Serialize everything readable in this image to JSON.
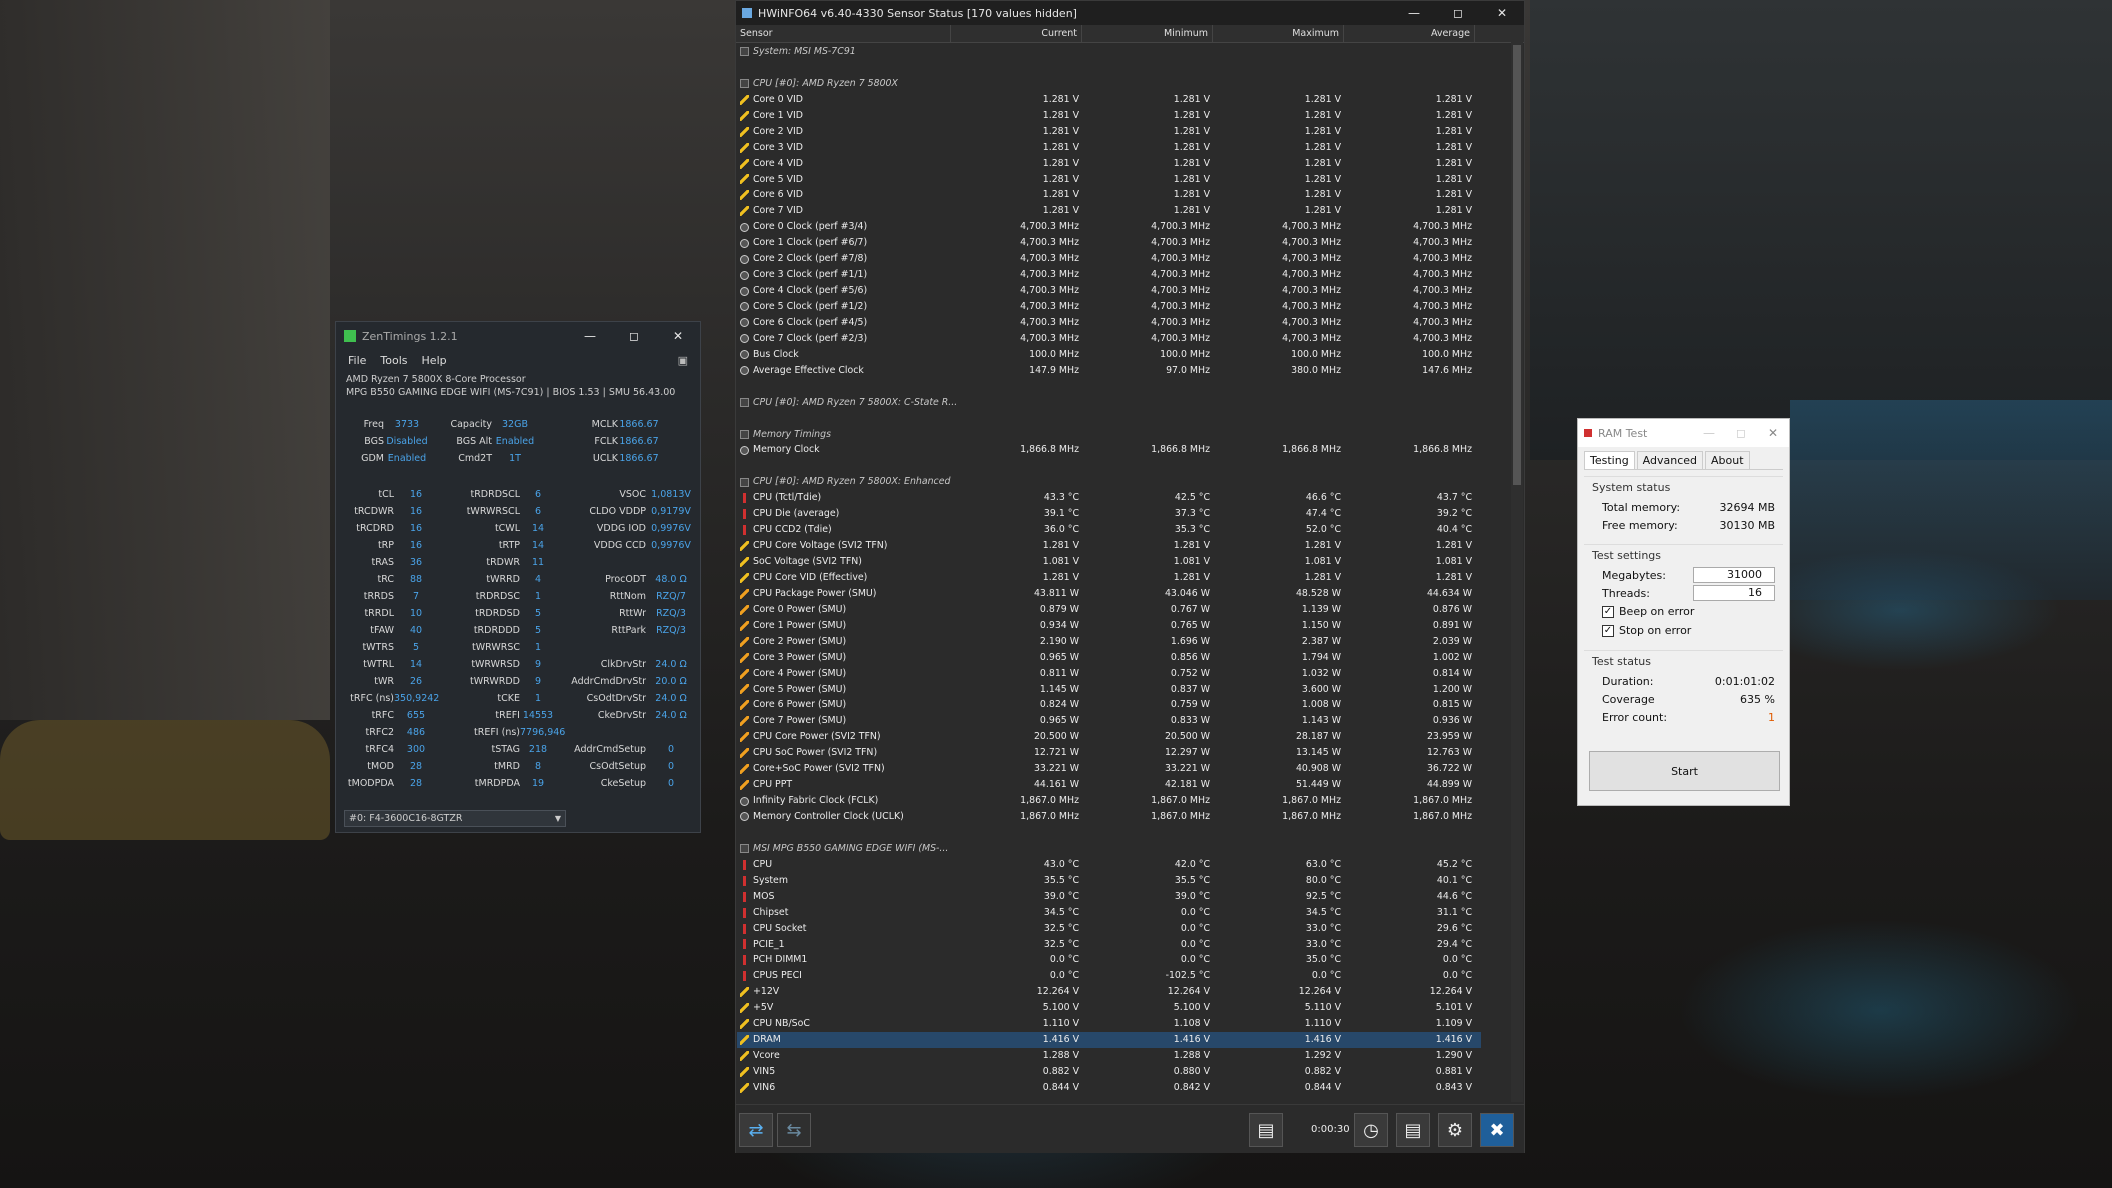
{
  "hwinfo": {
    "title": "HWiNFO64 v6.40-4330 Sensor Status [170 values hidden]",
    "columns": [
      "Sensor",
      "Current",
      "Minimum",
      "Maximum",
      "Average"
    ],
    "rows": [
      {
        "t": "grp",
        "n": "System: MSI MS-7C91"
      },
      {
        "t": "gap"
      },
      {
        "t": "grp",
        "n": "CPU [#0]: AMD Ryzen 7 5800X"
      },
      {
        "t": "volt",
        "n": "Core 0 VID",
        "v": [
          "1.281 V",
          "1.281 V",
          "1.281 V",
          "1.281 V"
        ]
      },
      {
        "t": "volt",
        "n": "Core 1 VID",
        "v": [
          "1.281 V",
          "1.281 V",
          "1.281 V",
          "1.281 V"
        ]
      },
      {
        "t": "volt",
        "n": "Core 2 VID",
        "v": [
          "1.281 V",
          "1.281 V",
          "1.281 V",
          "1.281 V"
        ]
      },
      {
        "t": "volt",
        "n": "Core 3 VID",
        "v": [
          "1.281 V",
          "1.281 V",
          "1.281 V",
          "1.281 V"
        ]
      },
      {
        "t": "volt",
        "n": "Core 4 VID",
        "v": [
          "1.281 V",
          "1.281 V",
          "1.281 V",
          "1.281 V"
        ]
      },
      {
        "t": "volt",
        "n": "Core 5 VID",
        "v": [
          "1.281 V",
          "1.281 V",
          "1.281 V",
          "1.281 V"
        ]
      },
      {
        "t": "volt",
        "n": "Core 6 VID",
        "v": [
          "1.281 V",
          "1.281 V",
          "1.281 V",
          "1.281 V"
        ]
      },
      {
        "t": "volt",
        "n": "Core 7 VID",
        "v": [
          "1.281 V",
          "1.281 V",
          "1.281 V",
          "1.281 V"
        ]
      },
      {
        "t": "clk",
        "n": "Core 0 Clock (perf #3/4)",
        "v": [
          "4,700.3 MHz",
          "4,700.3 MHz",
          "4,700.3 MHz",
          "4,700.3 MHz"
        ]
      },
      {
        "t": "clk",
        "n": "Core 1 Clock (perf #6/7)",
        "v": [
          "4,700.3 MHz",
          "4,700.3 MHz",
          "4,700.3 MHz",
          "4,700.3 MHz"
        ]
      },
      {
        "t": "clk",
        "n": "Core 2 Clock (perf #7/8)",
        "v": [
          "4,700.3 MHz",
          "4,700.3 MHz",
          "4,700.3 MHz",
          "4,700.3 MHz"
        ]
      },
      {
        "t": "clk",
        "n": "Core 3 Clock (perf #1/1)",
        "v": [
          "4,700.3 MHz",
          "4,700.3 MHz",
          "4,700.3 MHz",
          "4,700.3 MHz"
        ]
      },
      {
        "t": "clk",
        "n": "Core 4 Clock (perf #5/6)",
        "v": [
          "4,700.3 MHz",
          "4,700.3 MHz",
          "4,700.3 MHz",
          "4,700.3 MHz"
        ]
      },
      {
        "t": "clk",
        "n": "Core 5 Clock (perf #1/2)",
        "v": [
          "4,700.3 MHz",
          "4,700.3 MHz",
          "4,700.3 MHz",
          "4,700.3 MHz"
        ]
      },
      {
        "t": "clk",
        "n": "Core 6 Clock (perf #4/5)",
        "v": [
          "4,700.3 MHz",
          "4,700.3 MHz",
          "4,700.3 MHz",
          "4,700.3 MHz"
        ]
      },
      {
        "t": "clk",
        "n": "Core 7 Clock (perf #2/3)",
        "v": [
          "4,700.3 MHz",
          "4,700.3 MHz",
          "4,700.3 MHz",
          "4,700.3 MHz"
        ]
      },
      {
        "t": "clk",
        "n": "Bus Clock",
        "v": [
          "100.0 MHz",
          "100.0 MHz",
          "100.0 MHz",
          "100.0 MHz"
        ]
      },
      {
        "t": "clk",
        "n": "Average Effective Clock",
        "v": [
          "147.9 MHz",
          "97.0 MHz",
          "380.0 MHz",
          "147.6 MHz"
        ]
      },
      {
        "t": "gap"
      },
      {
        "t": "grp",
        "n": "CPU [#0]: AMD Ryzen 7 5800X: C-State R..."
      },
      {
        "t": "gap"
      },
      {
        "t": "grp",
        "n": "Memory Timings"
      },
      {
        "t": "clk",
        "n": "Memory Clock",
        "v": [
          "1,866.8 MHz",
          "1,866.8 MHz",
          "1,866.8 MHz",
          "1,866.8 MHz"
        ]
      },
      {
        "t": "gap"
      },
      {
        "t": "grp",
        "n": "CPU [#0]: AMD Ryzen 7 5800X: Enhanced"
      },
      {
        "t": "temp",
        "n": "CPU (Tctl/Tdie)",
        "v": [
          "43.3 °C",
          "42.5 °C",
          "46.6 °C",
          "43.7 °C"
        ]
      },
      {
        "t": "temp",
        "n": "CPU Die (average)",
        "v": [
          "39.1 °C",
          "37.3 °C",
          "47.4 °C",
          "39.2 °C"
        ]
      },
      {
        "t": "temp",
        "n": "CPU CCD2 (Tdie)",
        "v": [
          "36.0 °C",
          "35.3 °C",
          "52.0 °C",
          "40.4 °C"
        ]
      },
      {
        "t": "volt",
        "n": "CPU Core Voltage (SVI2 TFN)",
        "v": [
          "1.281 V",
          "1.281 V",
          "1.281 V",
          "1.281 V"
        ]
      },
      {
        "t": "volt",
        "n": "SoC Voltage (SVI2 TFN)",
        "v": [
          "1.081 V",
          "1.081 V",
          "1.081 V",
          "1.081 V"
        ]
      },
      {
        "t": "volt",
        "n": "CPU Core VID (Effective)",
        "v": [
          "1.281 V",
          "1.281 V",
          "1.281 V",
          "1.281 V"
        ]
      },
      {
        "t": "pwr",
        "n": "CPU Package Power (SMU)",
        "v": [
          "43.811 W",
          "43.046 W",
          "48.528 W",
          "44.634 W"
        ]
      },
      {
        "t": "pwr",
        "n": "Core 0 Power (SMU)",
        "v": [
          "0.879 W",
          "0.767 W",
          "1.139 W",
          "0.876 W"
        ]
      },
      {
        "t": "pwr",
        "n": "Core 1 Power (SMU)",
        "v": [
          "0.934 W",
          "0.765 W",
          "1.150 W",
          "0.891 W"
        ]
      },
      {
        "t": "pwr",
        "n": "Core 2 Power (SMU)",
        "v": [
          "2.190 W",
          "1.696 W",
          "2.387 W",
          "2.039 W"
        ]
      },
      {
        "t": "pwr",
        "n": "Core 3 Power (SMU)",
        "v": [
          "0.965 W",
          "0.856 W",
          "1.794 W",
          "1.002 W"
        ]
      },
      {
        "t": "pwr",
        "n": "Core 4 Power (SMU)",
        "v": [
          "0.811 W",
          "0.752 W",
          "1.032 W",
          "0.814 W"
        ]
      },
      {
        "t": "pwr",
        "n": "Core 5 Power (SMU)",
        "v": [
          "1.145 W",
          "0.837 W",
          "3.600 W",
          "1.200 W"
        ]
      },
      {
        "t": "pwr",
        "n": "Core 6 Power (SMU)",
        "v": [
          "0.824 W",
          "0.759 W",
          "1.008 W",
          "0.815 W"
        ]
      },
      {
        "t": "pwr",
        "n": "Core 7 Power (SMU)",
        "v": [
          "0.965 W",
          "0.833 W",
          "1.143 W",
          "0.936 W"
        ]
      },
      {
        "t": "pwr",
        "n": "CPU Core Power (SVI2 TFN)",
        "v": [
          "20.500 W",
          "20.500 W",
          "28.187 W",
          "23.959 W"
        ]
      },
      {
        "t": "pwr",
        "n": "CPU SoC Power (SVI2 TFN)",
        "v": [
          "12.721 W",
          "12.297 W",
          "13.145 W",
          "12.763 W"
        ]
      },
      {
        "t": "pwr",
        "n": "Core+SoC Power (SVI2 TFN)",
        "v": [
          "33.221 W",
          "33.221 W",
          "40.908 W",
          "36.722 W"
        ]
      },
      {
        "t": "pwr",
        "n": "CPU PPT",
        "v": [
          "44.161 W",
          "42.181 W",
          "51.449 W",
          "44.899 W"
        ]
      },
      {
        "t": "clk",
        "n": "Infinity Fabric Clock (FCLK)",
        "v": [
          "1,867.0 MHz",
          "1,867.0 MHz",
          "1,867.0 MHz",
          "1,867.0 MHz"
        ]
      },
      {
        "t": "clk",
        "n": "Memory Controller Clock (UCLK)",
        "v": [
          "1,867.0 MHz",
          "1,867.0 MHz",
          "1,867.0 MHz",
          "1,867.0 MHz"
        ]
      },
      {
        "t": "gap"
      },
      {
        "t": "grp",
        "n": "MSI MPG B550 GAMING EDGE WIFI (MS-..."
      },
      {
        "t": "temp",
        "n": "CPU",
        "v": [
          "43.0 °C",
          "42.0 °C",
          "63.0 °C",
          "45.2 °C"
        ]
      },
      {
        "t": "temp",
        "n": "System",
        "v": [
          "35.5 °C",
          "35.5 °C",
          "80.0 °C",
          "40.1 °C"
        ]
      },
      {
        "t": "temp",
        "n": "MOS",
        "v": [
          "39.0 °C",
          "39.0 °C",
          "92.5 °C",
          "44.6 °C"
        ]
      },
      {
        "t": "temp",
        "n": "Chipset",
        "v": [
          "34.5 °C",
          "0.0 °C",
          "34.5 °C",
          "31.1 °C"
        ]
      },
      {
        "t": "temp",
        "n": "CPU Socket",
        "v": [
          "32.5 °C",
          "0.0 °C",
          "33.0 °C",
          "29.6 °C"
        ]
      },
      {
        "t": "temp",
        "n": "PCIE_1",
        "v": [
          "32.5 °C",
          "0.0 °C",
          "33.0 °C",
          "29.4 °C"
        ]
      },
      {
        "t": "temp",
        "n": "PCH DIMM1",
        "v": [
          "0.0 °C",
          "0.0 °C",
          "35.0 °C",
          "0.0 °C"
        ]
      },
      {
        "t": "temp",
        "n": "CPUS PECI",
        "v": [
          "0.0 °C",
          "-102.5 °C",
          "0.0 °C",
          "0.0 °C"
        ]
      },
      {
        "t": "volt",
        "n": "+12V",
        "v": [
          "12.264 V",
          "12.264 V",
          "12.264 V",
          "12.264 V"
        ]
      },
      {
        "t": "volt",
        "n": "+5V",
        "v": [
          "5.100 V",
          "5.100 V",
          "5.110 V",
          "5.101 V"
        ]
      },
      {
        "t": "volt",
        "n": "CPU NB/SoC",
        "v": [
          "1.110 V",
          "1.108 V",
          "1.110 V",
          "1.109 V"
        ]
      },
      {
        "t": "volt",
        "n": "DRAM",
        "v": [
          "1.416 V",
          "1.416 V",
          "1.416 V",
          "1.416 V"
        ],
        "sel": true
      },
      {
        "t": "volt",
        "n": "Vcore",
        "v": [
          "1.288 V",
          "1.288 V",
          "1.292 V",
          "1.290 V"
        ]
      },
      {
        "t": "volt",
        "n": "VIN5",
        "v": [
          "0.882 V",
          "0.880 V",
          "0.882 V",
          "0.881 V"
        ]
      },
      {
        "t": "volt",
        "n": "VIN6",
        "v": [
          "0.844 V",
          "0.842 V",
          "0.844 V",
          "0.843 V"
        ]
      }
    ],
    "footer": {
      "elapsed": "0:00:30"
    }
  },
  "zentimings": {
    "title": "ZenTimings 1.2.1",
    "menu": [
      "File",
      "Tools",
      "Help"
    ],
    "cpu": "AMD Ryzen 7 5800X 8-Core Processor",
    "board": "MPG B550 GAMING EDGE WIFI (MS-7C91) | BIOS 1.53 | SMU 56.43.00",
    "top": [
      [
        "Freq",
        "3733",
        "Capacity",
        "32GB",
        "MCLK",
        "1866.67"
      ],
      [
        "BGS",
        "Disabled",
        "BGS Alt",
        "Enabled",
        "FCLK",
        "1866.67"
      ],
      [
        "GDM",
        "Enabled",
        "Cmd2T",
        "1T",
        "UCLK",
        "1866.67"
      ]
    ],
    "timings": [
      [
        "tCL",
        "16",
        "tRDRDSCL",
        "6"
      ],
      [
        "tRCDWR",
        "16",
        "tWRWRSCL",
        "6"
      ],
      [
        "tRCDRD",
        "16",
        "tCWL",
        "14"
      ],
      [
        "tRP",
        "16",
        "tRTP",
        "14"
      ],
      [
        "tRAS",
        "36",
        "tRDWR",
        "11"
      ],
      [
        "tRC",
        "88",
        "tWRRD",
        "4"
      ],
      [
        "tRRDS",
        "7",
        "tRDRDSC",
        "1"
      ],
      [
        "tRRDL",
        "10",
        "tRDRDSD",
        "5"
      ],
      [
        "tFAW",
        "40",
        "tRDRDDD",
        "5"
      ],
      [
        "tWTRS",
        "5",
        "tWRWRSC",
        "1"
      ],
      [
        "tWTRL",
        "14",
        "tWRWRSD",
        "9"
      ],
      [
        "tWR",
        "26",
        "tWRWRDD",
        "9"
      ],
      [
        "tRFC (ns)",
        "350,9242",
        "tCKE",
        "1"
      ],
      [
        "tRFC",
        "655",
        "tREFI",
        "14553"
      ],
      [
        "tRFC2",
        "486",
        "tREFI (ns)",
        "7796,946"
      ],
      [
        "tRFC4",
        "300",
        "tSTAG",
        "218"
      ],
      [
        "tMOD",
        "28",
        "tMRD",
        "8"
      ],
      [
        "tMODPDA",
        "28",
        "tMRDPDA",
        "19"
      ]
    ],
    "volts": [
      [
        "VSOC",
        "1,0813V"
      ],
      [
        "CLDO VDDP",
        "0,9179V"
      ],
      [
        "VDDG IOD",
        "0,9976V"
      ],
      [
        "VDDG CCD",
        "0,9976V"
      ],
      [
        "",
        ""
      ],
      [
        "ProcODT",
        "48.0 Ω"
      ],
      [
        "RttNom",
        "RZQ/7"
      ],
      [
        "RttWr",
        "RZQ/3"
      ],
      [
        "RttPark",
        "RZQ/3"
      ],
      [
        "",
        ""
      ],
      [
        "ClkDrvStr",
        "24.0 Ω"
      ],
      [
        "AddrCmdDrvStr",
        "20.0 Ω"
      ],
      [
        "CsOdtDrvStr",
        "24.0 Ω"
      ],
      [
        "CkeDrvStr",
        "24.0 Ω"
      ],
      [
        "",
        ""
      ],
      [
        "AddrCmdSetup",
        "0"
      ],
      [
        "CsOdtSetup",
        "0"
      ],
      [
        "CkeSetup",
        "0"
      ]
    ],
    "dimm": "#0: F4-3600C16-8GTZR"
  },
  "ramtest": {
    "title": "RAM Test",
    "tabs": [
      "Testing",
      "Advanced",
      "About"
    ],
    "system_status": "System status",
    "total_label": "Total memory:",
    "total": "32694 MB",
    "free_label": "Free memory:",
    "free": "30130 MB",
    "test_settings": "Test settings",
    "mb_label": "Megabytes:",
    "mb": "31000",
    "thr_label": "Threads:",
    "thr": "16",
    "beep": "Beep on error",
    "stop": "Stop on error",
    "test_status": "Test status",
    "dur_label": "Duration:",
    "dur": "0:01:01:02",
    "cov_label": "Coverage",
    "cov": "635 %",
    "err_label": "Error count:",
    "err": "1",
    "start": "Start"
  },
  "colors": {
    "zen_value": "#4aa3e8",
    "selection": "#27486a",
    "error": "#e05a00"
  }
}
